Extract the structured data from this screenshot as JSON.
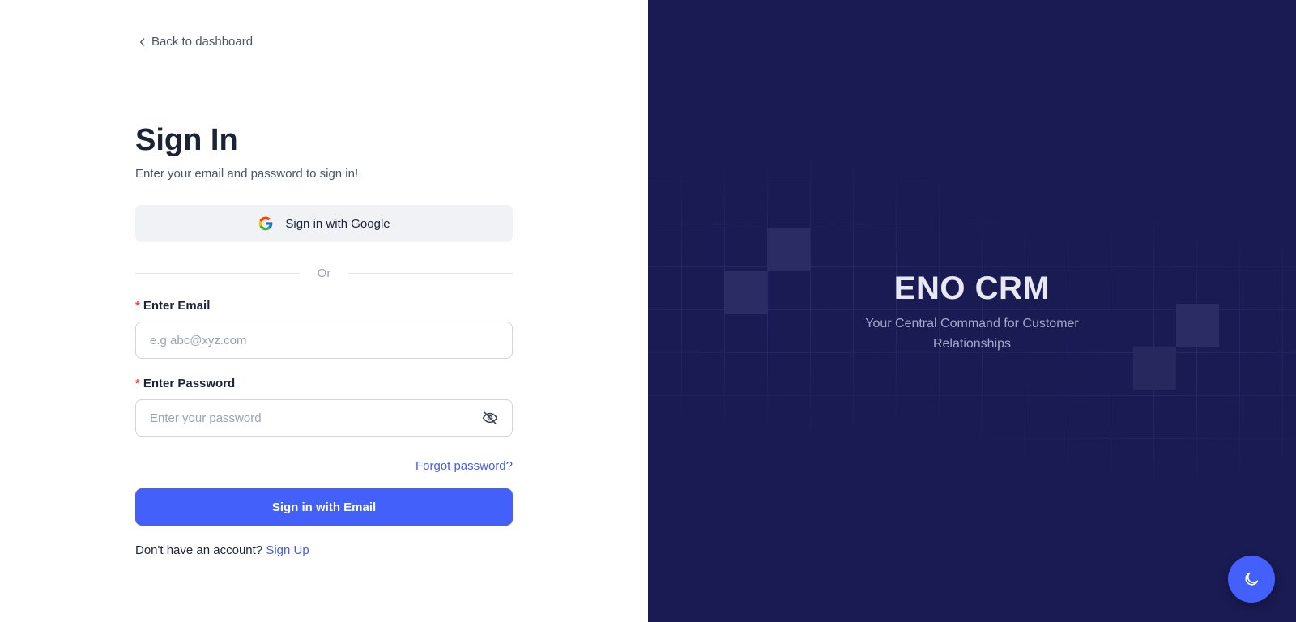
{
  "back_link": {
    "label": "Back to dashboard"
  },
  "signin": {
    "title": "Sign In",
    "subtitle": "Enter your email and password to sign in!",
    "google_label": "Sign in with Google",
    "divider": "Or",
    "email": {
      "required_mark": "*",
      "label": "Enter Email",
      "placeholder": "e.g abc@xyz.com",
      "value": ""
    },
    "password": {
      "required_mark": "*",
      "label": "Enter Password",
      "placeholder": "Enter your password",
      "value": ""
    },
    "forgot": "Forgot password?",
    "submit": "Sign in with Email",
    "signup_prompt": "Don't have an account?",
    "signup_link": "Sign Up"
  },
  "brand": {
    "title": "ENO CRM",
    "subtitle": "Your Central Command for Customer Relationships"
  },
  "icons": {
    "back": "chevron-left-icon",
    "google": "google-icon",
    "password_toggle": "eye-off-icon",
    "theme": "moon-icon"
  },
  "colors": {
    "primary": "#4460fa",
    "link": "#4360df",
    "brand_panel": "#191b52",
    "heading": "#1b2437",
    "required": "#ef4444"
  }
}
